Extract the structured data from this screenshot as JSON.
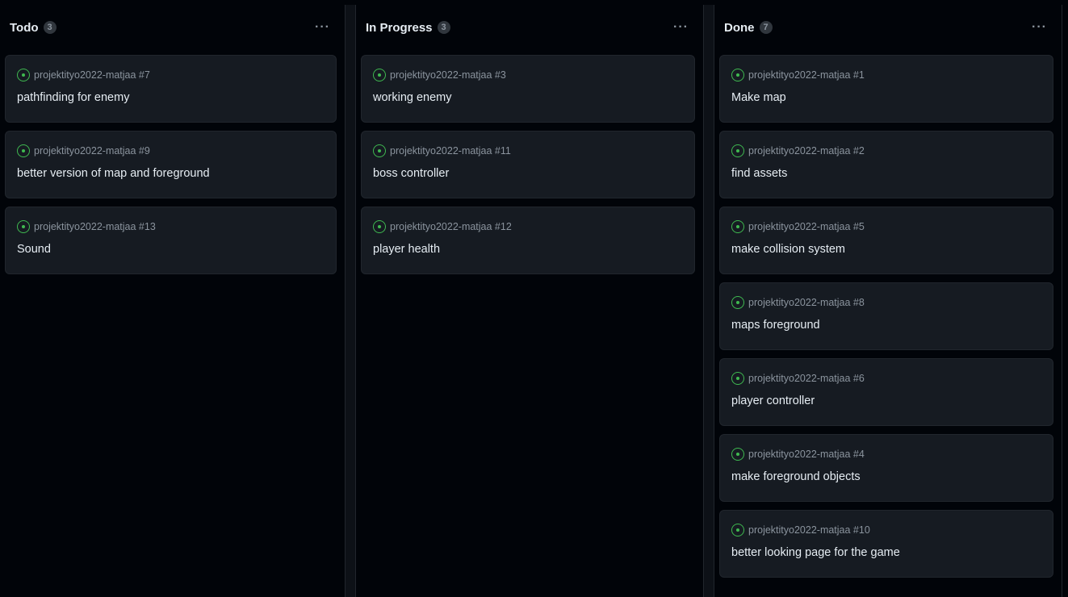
{
  "columns": [
    {
      "name": "Todo",
      "count": "3",
      "cards": [
        {
          "repo": "projektityo2022-matjaa #7",
          "title": "pathfinding for enemy"
        },
        {
          "repo": "projektityo2022-matjaa #9",
          "title": "better version of map and foreground"
        },
        {
          "repo": "projektityo2022-matjaa #13",
          "title": "Sound"
        }
      ]
    },
    {
      "name": "In Progress",
      "count": "3",
      "cards": [
        {
          "repo": "projektityo2022-matjaa #3",
          "title": "working enemy"
        },
        {
          "repo": "projektityo2022-matjaa #11",
          "title": "boss controller"
        },
        {
          "repo": "projektityo2022-matjaa #12",
          "title": "player health"
        }
      ]
    },
    {
      "name": "Done",
      "count": "7",
      "cards": [
        {
          "repo": "projektityo2022-matjaa #1",
          "title": "Make map"
        },
        {
          "repo": "projektityo2022-matjaa #2",
          "title": "find assets"
        },
        {
          "repo": "projektityo2022-matjaa #5",
          "title": "make collision system"
        },
        {
          "repo": "projektityo2022-matjaa #8",
          "title": "maps foreground"
        },
        {
          "repo": "projektityo2022-matjaa #6",
          "title": "player controller"
        },
        {
          "repo": "projektityo2022-matjaa #4",
          "title": "make foreground objects"
        },
        {
          "repo": "projektityo2022-matjaa #10",
          "title": "better looking page for the game"
        }
      ]
    }
  ],
  "more_label": "···",
  "icons": {
    "card_status": "issue-opened-icon",
    "column_menu": "kebab-horizontal-icon"
  },
  "colors": {
    "open_issue": "#3fb950",
    "card_bg": "#161b22",
    "page_bg": "#010409",
    "muted_text": "#8b949e"
  }
}
